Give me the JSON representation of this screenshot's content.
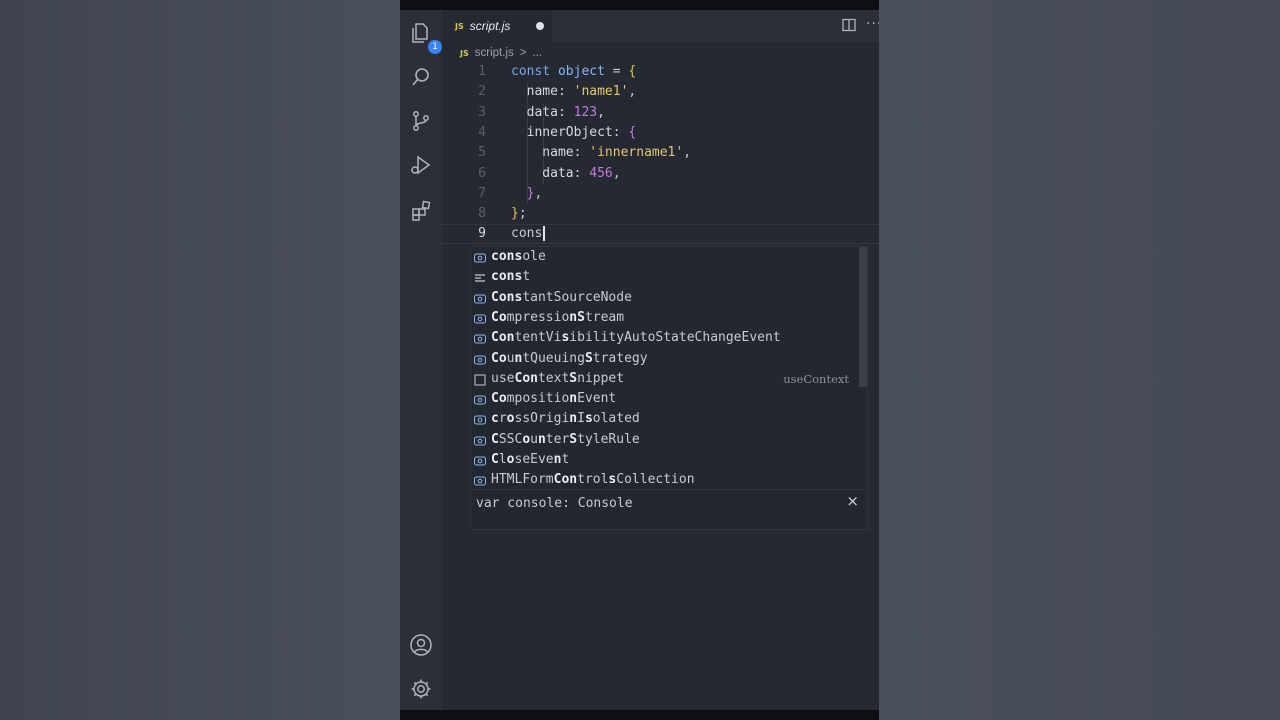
{
  "tab": {
    "badge": "JS",
    "filename": "script.js"
  },
  "breadcrumb": {
    "badge": "JS",
    "file": "script.js",
    "sep": ">",
    "more": "..."
  },
  "activity": {
    "explorer_badge": "1"
  },
  "editor": {
    "lines": [
      {
        "n": "1",
        "tokens": [
          [
            "kw",
            "const"
          ],
          [
            "punc",
            " "
          ],
          [
            "var",
            "object"
          ],
          [
            "punc",
            " = "
          ],
          [
            "brace",
            "{"
          ]
        ]
      },
      {
        "n": "2",
        "tokens": [
          [
            "prop",
            "  name"
          ],
          [
            "punc",
            ": "
          ],
          [
            "str",
            "'name1'"
          ],
          [
            "punc",
            ","
          ]
        ]
      },
      {
        "n": "3",
        "tokens": [
          [
            "prop",
            "  data"
          ],
          [
            "punc",
            ": "
          ],
          [
            "num",
            "123"
          ],
          [
            "punc",
            ","
          ]
        ]
      },
      {
        "n": "4",
        "tokens": [
          [
            "prop",
            "  innerObject"
          ],
          [
            "punc",
            ": "
          ],
          [
            "brace2",
            "{"
          ]
        ]
      },
      {
        "n": "5",
        "tokens": [
          [
            "prop",
            "    name"
          ],
          [
            "punc",
            ": "
          ],
          [
            "str",
            "'innername1'"
          ],
          [
            "punc",
            ","
          ]
        ]
      },
      {
        "n": "6",
        "tokens": [
          [
            "prop",
            "    data"
          ],
          [
            "punc",
            ": "
          ],
          [
            "num",
            "456"
          ],
          [
            "punc",
            ","
          ]
        ]
      },
      {
        "n": "7",
        "tokens": [
          [
            "brace2",
            "  }"
          ],
          [
            "punc",
            ","
          ]
        ]
      },
      {
        "n": "8",
        "tokens": [
          [
            "brace",
            "}"
          ],
          [
            "punc",
            ";"
          ]
        ]
      },
      {
        "n": "9",
        "tokens": [
          [
            "punc",
            "cons"
          ]
        ]
      }
    ]
  },
  "suggestions": [
    {
      "kind": "variable",
      "label": "console",
      "match": "cons",
      "detail": ""
    },
    {
      "kind": "keyword",
      "label": "const",
      "match": "cons",
      "detail": ""
    },
    {
      "kind": "variable",
      "label": "ConstantSourceNode",
      "match": "Cons",
      "detail": ""
    },
    {
      "kind": "variable",
      "label": "CompressionStream",
      "match": "Co",
      "detail": ""
    },
    {
      "kind": "variable",
      "label": "ContentVisibilityAutoStateChangeEvent",
      "match": "Con",
      "detail": ""
    },
    {
      "kind": "variable",
      "label": "CountQueuingStrategy",
      "match": "Co",
      "detail": ""
    },
    {
      "kind": "snippet",
      "label": "useContextSnippet",
      "match": "",
      "detail": "useContext"
    },
    {
      "kind": "variable",
      "label": "CompositionEvent",
      "match": "Co",
      "detail": ""
    },
    {
      "kind": "variable",
      "label": "crossOriginIsolated",
      "match": "c",
      "detail": ""
    },
    {
      "kind": "variable",
      "label": "CSSCounterStyleRule",
      "match": "C",
      "detail": ""
    },
    {
      "kind": "variable",
      "label": "CloseEvent",
      "match": "C",
      "detail": ""
    },
    {
      "kind": "variable",
      "label": "HTMLFormControlsCollection",
      "match": "",
      "detail": ""
    }
  ],
  "details": {
    "signature": "var console: Console",
    "close": "×"
  },
  "colors": {
    "accent": "#3b82f6",
    "editor_bg": "#252931",
    "string": "#e7c56e",
    "number": "#c678dd"
  }
}
